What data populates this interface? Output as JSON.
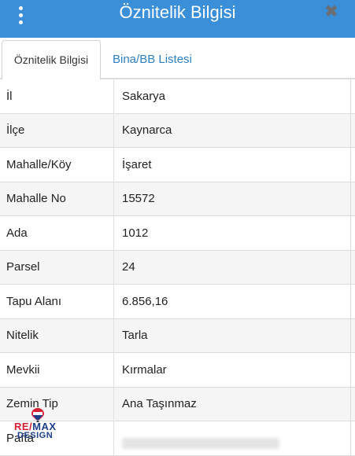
{
  "header": {
    "title": "Öznitelik Bilgisi",
    "menu_icon": "kebab-menu-icon",
    "close_icon": "close-icon",
    "close_glyph": "✖",
    "color": "#3a8fd8"
  },
  "tabs": [
    {
      "label": "Öznitelik Bilgisi",
      "active": true
    },
    {
      "label": "Bina/BB Listesi",
      "active": false
    }
  ],
  "rows": [
    {
      "key": "İl",
      "value": "Sakarya"
    },
    {
      "key": "İlçe",
      "value": "Kaynarca"
    },
    {
      "key": "Mahalle/Köy",
      "value": "İşaret"
    },
    {
      "key": "Mahalle No",
      "value": "15572"
    },
    {
      "key": "Ada",
      "value": "1012"
    },
    {
      "key": "Parsel",
      "value": "24"
    },
    {
      "key": "Tapu Alanı",
      "value": "6.856,16"
    },
    {
      "key": "Nitelik",
      "value": "Tarla"
    },
    {
      "key": "Mevkii",
      "value": "Kırmalar"
    },
    {
      "key": "Zemin Tip",
      "value": "Ana Taşınmaz"
    },
    {
      "key": "Pafta",
      "value": ""
    }
  ],
  "logo": {
    "re": "RE/",
    "max": "MAX",
    "sub": "DESIGN"
  }
}
